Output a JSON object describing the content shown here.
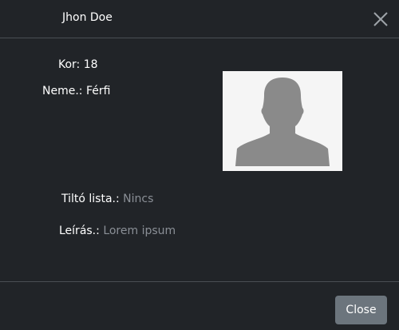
{
  "header": {
    "title": "Jhon Doe",
    "close_icon": "close-icon"
  },
  "profile": {
    "age_label": "Kor:",
    "age_value": "18",
    "gender_label": "Neme.:",
    "gender_value": "Férfi",
    "photo_icon": "avatar-silhouette-icon",
    "blocklist_label": "Tiltó lista.:",
    "blocklist_value": "Nincs",
    "description_label": "Leírás.:",
    "description_value": "Lorem ipsum"
  },
  "footer": {
    "close_label": "Close"
  },
  "colors": {
    "background": "#212428",
    "divider": "#4a4e54",
    "muted_text": "#8a8f96",
    "button_bg": "#6c757d",
    "photo_bg": "#f5f5f5",
    "silhouette": "#8a8a8a"
  }
}
